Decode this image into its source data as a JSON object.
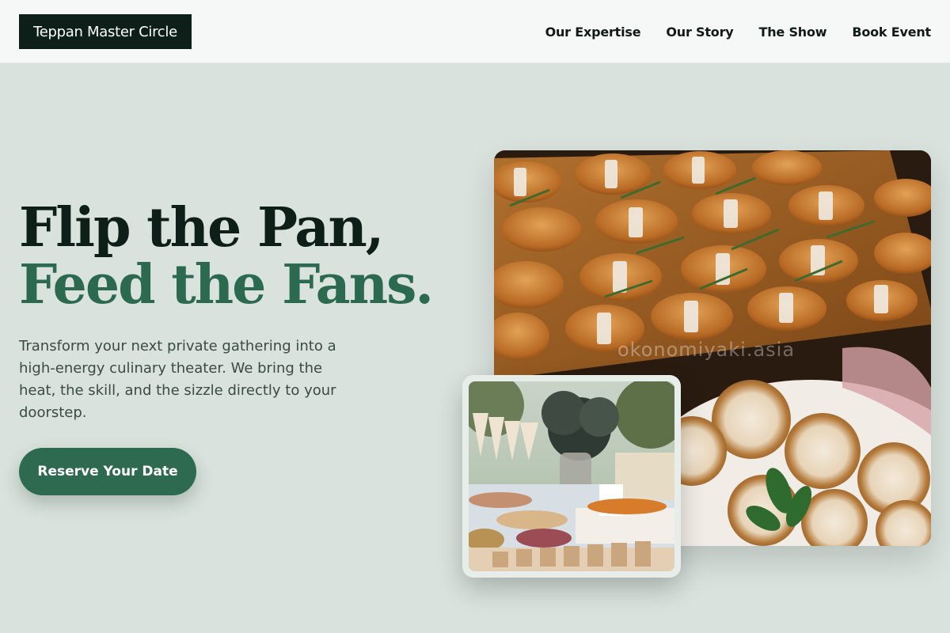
{
  "brand": {
    "name": "Teppan Master Circle"
  },
  "nav": [
    {
      "label": "Our Expertise"
    },
    {
      "label": "Our Story"
    },
    {
      "label": "The Show"
    },
    {
      "label": "Book Event"
    }
  ],
  "hero": {
    "title_line1": "Flip the Pan,",
    "title_line2": "Feed the Fans.",
    "lead": "Transform your next private gathering into a high-energy culinary theater. We bring the heat, the skill, and the sizzle directly to your doorstep.",
    "cta_label": "Reserve Your Date"
  },
  "images": {
    "main_watermark": "okonomiyaki.asia"
  },
  "colors": {
    "accent": "#2e6a50",
    "headline_dark": "#0d1f18",
    "headline_green": "#2b6a4f",
    "background": "#d9e2dd"
  }
}
